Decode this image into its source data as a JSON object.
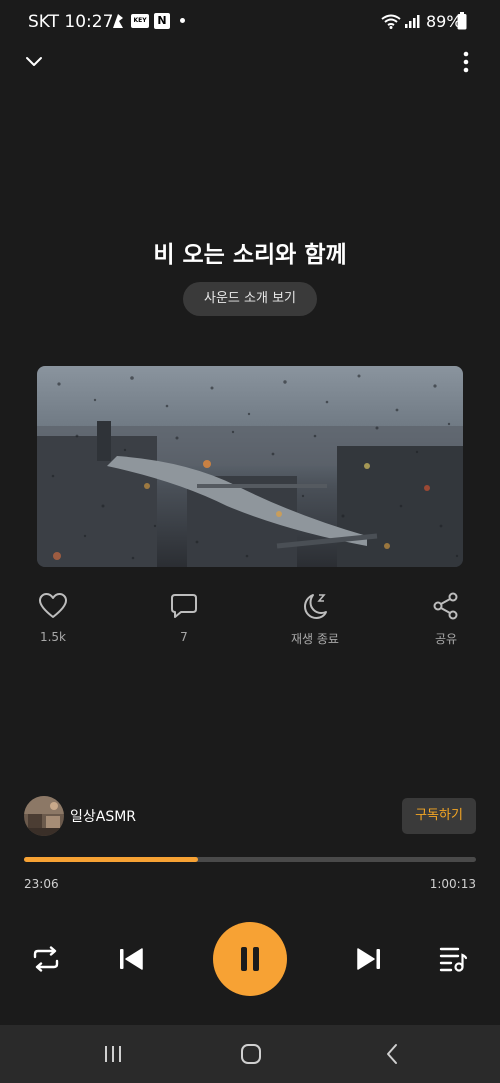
{
  "status_bar": {
    "time": "SKT 10:27",
    "key_badge": "KEY",
    "n_badge": "N",
    "battery": "89%"
  },
  "player": {
    "title": "비 오는 소리와 함께",
    "sound_intro_button": "사운드 소개 보기",
    "actions": {
      "like_count": "1.5k",
      "comment_count": "7",
      "sleep_timer_label": "재생 종료",
      "share_label": "공유"
    },
    "channel": {
      "name": "일상ASMR",
      "subscribe_label": "구독하기"
    },
    "progress": {
      "elapsed": "23:06",
      "total": "1:00:13",
      "fraction": 0.384
    }
  },
  "colors": {
    "accent": "#f7a234",
    "background": "#1b1b1b",
    "button_bg": "#3a3a3a",
    "nav_bar": "#2a2a2a"
  },
  "icons": {
    "top_left": "chevron-down-icon",
    "top_right": "more-vertical-icon",
    "like": "heart-icon",
    "comment": "comment-icon",
    "sleep": "moon-icon",
    "share": "share-icon",
    "repeat": "repeat-icon",
    "previous": "skip-previous-icon",
    "play_pause": "pause-icon",
    "next": "skip-next-icon",
    "playlist": "playlist-icon"
  }
}
